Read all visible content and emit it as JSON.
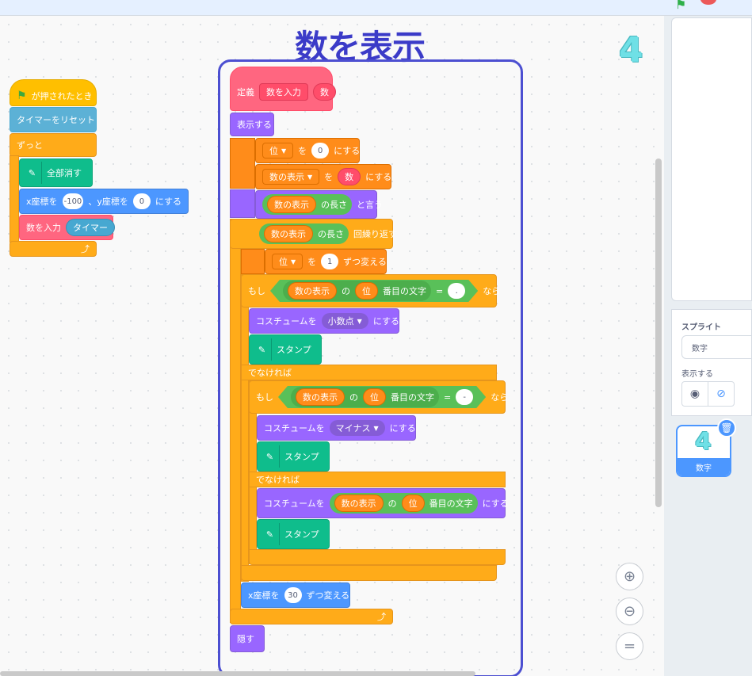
{
  "title": "数を表示",
  "corner_digit": "4",
  "script_left": {
    "hat": "が押されたとき",
    "reset_timer": "タイマーをリセット",
    "forever": "ずっと",
    "clear": "全部消す",
    "goto_x": "x座標を",
    "goto_x_val": "-100",
    "goto_sep": "、y座標を",
    "goto_y_val": "0",
    "goto_end": "にする",
    "input": "数を入力",
    "input_arg": "タイマー"
  },
  "script_def": {
    "define": "定義",
    "define_name": "数を入力",
    "define_param": "数",
    "show": "表示する",
    "set1_var": "位",
    "set1_to": "を",
    "set1_val": "0",
    "set1_end": "にする",
    "set2_var": "数の表示",
    "set2_to": "を",
    "set2_val": "数",
    "set2_end": "にする",
    "say_val": "数の表示",
    "say_len": "の長さ",
    "say_end": "と言う",
    "repeat_val": "数の表示",
    "repeat_len": "の長さ",
    "repeat_end": "回繰り返す",
    "change_var": "位",
    "change_by": "を",
    "change_val": "1",
    "change_end": "ずつ変える",
    "if1": "もし",
    "if1_str": "数の表示",
    "if1_of": "の",
    "if1_idx": "位",
    "if1_letter": "番目の文字",
    "if1_eq": "=",
    "if1_cmp": ".",
    "if1_then": "なら",
    "costume1": "コスチュームを",
    "costume1_val": "小数点",
    "costume1_end": "にする",
    "stamp": "スタンプ",
    "else1": "でなければ",
    "if2": "もし",
    "if2_str": "数の表示",
    "if2_of": "の",
    "if2_idx": "位",
    "if2_letter": "番目の文字",
    "if2_eq": "=",
    "if2_cmp": "-",
    "if2_then": "なら",
    "costume2": "コスチュームを",
    "costume2_val": "マイナス",
    "costume2_end": "にする",
    "else2": "でなければ",
    "costume3": "コスチュームを",
    "costume3_str": "数の表示",
    "costume3_of": "の",
    "costume3_idx": "位",
    "costume3_letter": "番目の文字",
    "costume3_end": "にする",
    "changex": "x座標を",
    "changex_val": "30",
    "changex_end": "ずつ変える",
    "hide": "隠す"
  },
  "sprite_pane": {
    "label": "スプライト",
    "name": "数字",
    "show_label": "表示する",
    "sprite_tile_name": "数字",
    "sprite_tile_digit": "4"
  },
  "colors": {
    "events": "#ffbf00",
    "control": "#ffab19",
    "motion": "#4c97ff",
    "looks": "#9966ff",
    "pen": "#0fbd8c",
    "variables": "#ff8c1a",
    "operators": "#59c059",
    "myblocks": "#ff6680",
    "title": "#3b3bc8"
  }
}
